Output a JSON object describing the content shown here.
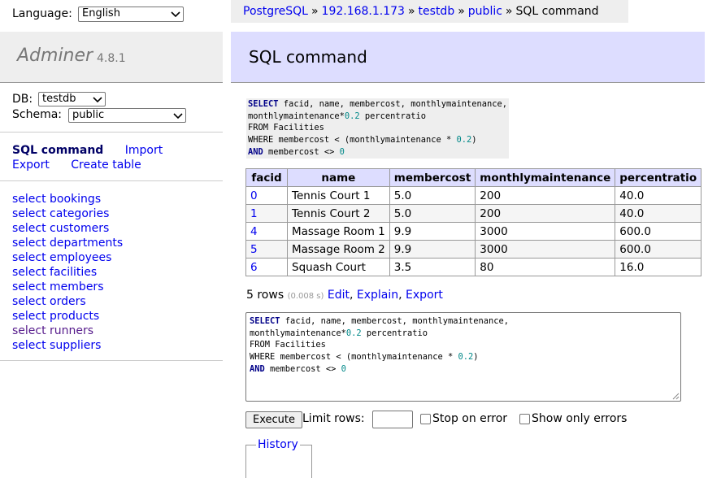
{
  "language": {
    "label": "Language:",
    "selected": "English"
  },
  "logo": {
    "name": "Adminer",
    "version": "4.8.1"
  },
  "db": {
    "db_label": "DB:",
    "db_selected": "testdb",
    "schema_label": "Schema:",
    "schema_selected": "public"
  },
  "commands": {
    "sql_command": "SQL command",
    "import": "Import",
    "export": "Export",
    "create_table": "Create table"
  },
  "tables": [
    "select bookings",
    "select categories",
    "select customers",
    "select departments",
    "select employees",
    "select facilities",
    "select members",
    "select orders",
    "select products",
    "select runners",
    "select suppliers"
  ],
  "breadcrumb": {
    "driver": "PostgreSQL",
    "host": "192.168.1.173",
    "database": "testdb",
    "schema": "public",
    "current": "SQL command",
    "separator": "»"
  },
  "page_title": "SQL command",
  "query": {
    "select_kw": "SELECT",
    "line1_rest": " facid, name, membercost, monthlymaintenance,",
    "line2_a": "monthlymaintenance*",
    "line2_num": "0.2",
    "line2_b": " percentratio",
    "line3": "FROM Facilities",
    "line4_a": "WHERE membercost < (monthlymaintenance * ",
    "line4_num": "0.2",
    "line4_b": ")",
    "and_kw": "AND",
    "line5_a": " membercost <> ",
    "line5_num": "0"
  },
  "result": {
    "columns": [
      "facid",
      "name",
      "membercost",
      "monthlymaintenance",
      "percentratio"
    ],
    "rows": [
      [
        "0",
        "Tennis Court 1",
        "5.0",
        "200",
        "40.0"
      ],
      [
        "1",
        "Tennis Court 2",
        "5.0",
        "200",
        "40.0"
      ],
      [
        "4",
        "Massage Room 1",
        "9.9",
        "3000",
        "600.0"
      ],
      [
        "5",
        "Massage Room 2",
        "9.9",
        "3000",
        "600.0"
      ],
      [
        "6",
        "Squash Court",
        "3.5",
        "80",
        "16.0"
      ]
    ]
  },
  "rows_info": {
    "count": "5 rows",
    "time": "(0.008 s)",
    "edit": "Edit",
    "explain": "Explain",
    "export": "Export",
    "comma": ","
  },
  "editor": {
    "execute_label": "Execute",
    "limit_label": "Limit rows:",
    "limit_value": "",
    "stop_on_error": "Stop on error",
    "stop_on_error_checked": false,
    "show_only_errors": "Show only errors",
    "show_only_errors_checked": false
  },
  "history_label": "History",
  "colors": {
    "link": "#0000ee",
    "title_bg": "#ddf",
    "panel_bg": "#eee",
    "keyword": "#008",
    "number": "#088"
  }
}
